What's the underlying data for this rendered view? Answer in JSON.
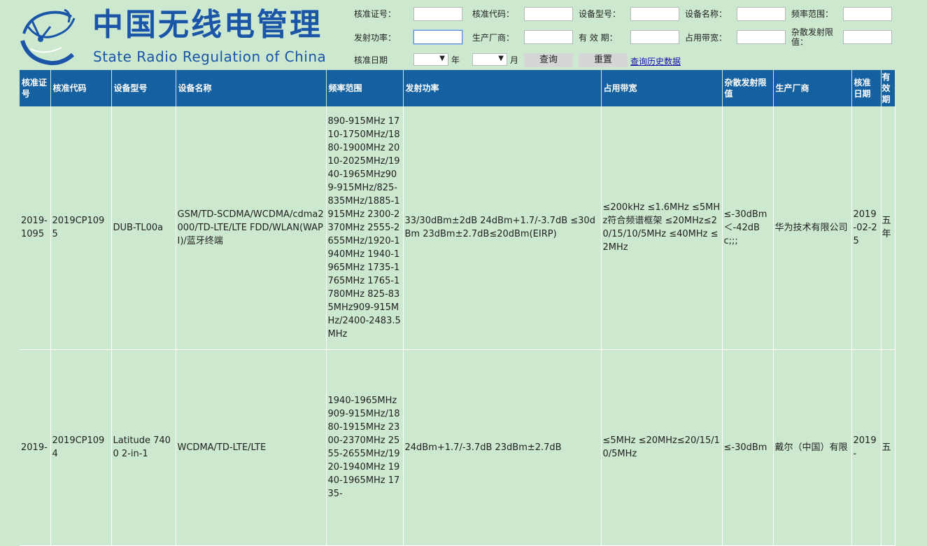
{
  "brand": {
    "cn": "中国无线电管理",
    "en": "State Radio Regulation of China"
  },
  "form": {
    "cert_no_label": "核准证号：",
    "approval_code_label": "核准代码：",
    "model_label": "设备型号：",
    "device_name_label": "设备名称：",
    "freq_range_label": "频率范围：",
    "tx_power_label": "发射功率：",
    "manufacturer_label": "生产厂商：",
    "validity_label": "有 效 期：",
    "bandwidth_label": "占用带宽：",
    "spurious_label": "杂散发射限值：",
    "date_label": "核准日期",
    "year_label": "年",
    "month_label": "月",
    "query_button": "查询",
    "reset_button": "重置",
    "history_link": "查询历史数据"
  },
  "table": {
    "headers": [
      "核准证号",
      "核准代码",
      "设备型号",
      "设备名称",
      "频率范围",
      "发射功率",
      "占用带宽",
      "杂散发射限值",
      "生产厂商",
      "核准日期",
      "有效期"
    ],
    "rows": [
      {
        "cert_no": "2019-1095",
        "approval_code": "2019CP1095",
        "model": "DUB-TL00a",
        "device_name": "GSM/TD-SCDMA/WCDMA/cdma2000/TD-LTE/LTE FDD/WLAN(WAPI)/蓝牙终端",
        "freq_range": "890-915MHz 1710-1750MHz/1880-1900MHz 2010-2025MHz/1940-1965MHz909-915MHz/825-835MHz/1885-1915MHz 2300-2370MHz 2555-2655MHz/1920-1940MHz 1940-1965MHz 1735-1765MHz 1765-1780MHz 825-835MHz909-915MHz/2400-2483.5MHz",
        "tx_power": "33/30dBm±2dB 24dBm+1.7/-3.7dB ≤30dBm 23dBm±2.7dB≤20dBm(EIRP)",
        "bandwidth": "≤200kHz ≤1.6MHz ≤5MHz符合频谱框架 ≤20MHz≤20/15/10/5MHz ≤40MHz ≤2MHz",
        "spurious": "≤-30dBm＜-42dBc;;;",
        "manufacturer": "华为技术有限公司",
        "date": "2019-02-25",
        "validity": "五年"
      },
      {
        "cert_no": "2019-",
        "approval_code": "2019CP1094",
        "model": "Latitude 7400 2-in-1",
        "device_name": "WCDMA/TD-LTE/LTE",
        "freq_range": "1940-1965MHz 909-915MHz/1880-1915MHz 2300-2370MHz 2555-2655MHz/1920-1940MHz 1940-1965MHz 1735-",
        "tx_power": "24dBm+1.7/-3.7dB 23dBm±2.7dB",
        "bandwidth": "≤5MHz ≤20MHz≤20/15/10/5MHz",
        "spurious": "≤-30dBm",
        "manufacturer": "戴尔（中国）有限",
        "date": "2019-",
        "validity": "五"
      }
    ]
  }
}
